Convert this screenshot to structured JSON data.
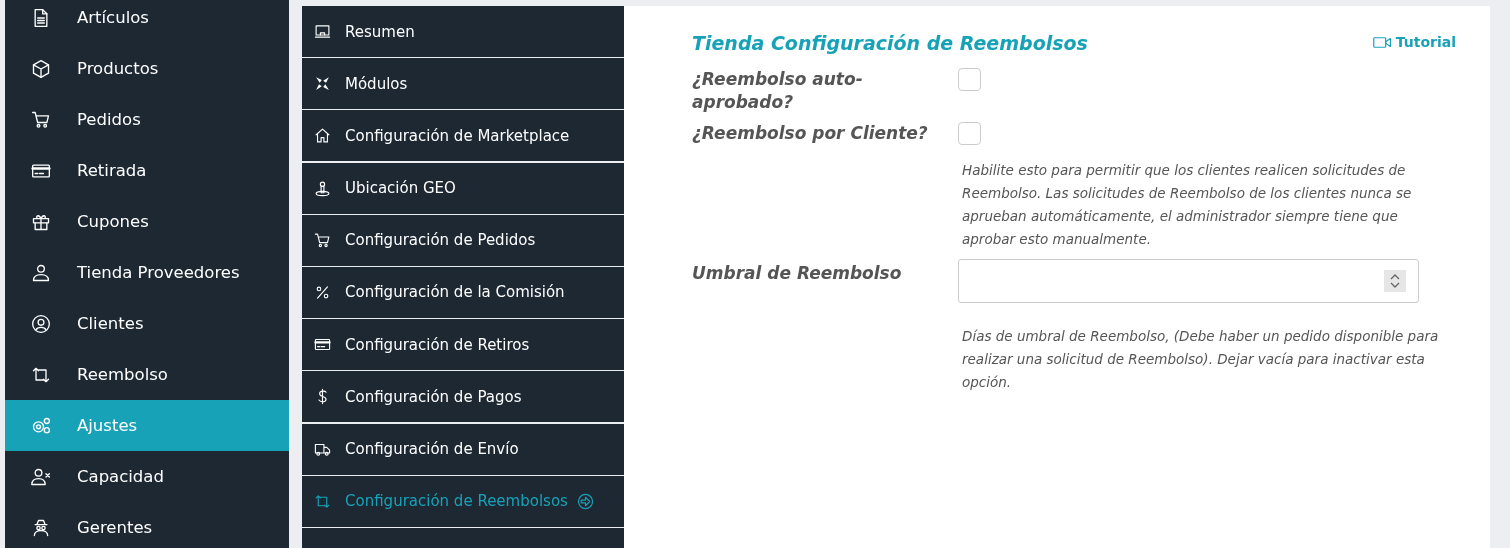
{
  "sidebar": {
    "items": [
      {
        "label": "Artículos",
        "selected": false
      },
      {
        "label": "Productos",
        "selected": false
      },
      {
        "label": "Pedidos",
        "selected": false
      },
      {
        "label": "Retirada",
        "selected": false
      },
      {
        "label": "Cupones",
        "selected": false
      },
      {
        "label": "Tienda Proveedores",
        "selected": false
      },
      {
        "label": "Clientes",
        "selected": false
      },
      {
        "label": "Reembolso",
        "selected": false
      },
      {
        "label": "Ajustes",
        "selected": true
      },
      {
        "label": "Capacidad",
        "selected": false
      },
      {
        "label": "Gerentes",
        "selected": false
      }
    ]
  },
  "settings_menu": {
    "items": [
      {
        "label": "Resumen",
        "selected": false
      },
      {
        "label": "Módulos",
        "selected": false
      },
      {
        "label": "Configuración de Marketplace",
        "selected": false
      },
      {
        "label": "Ubicación GEO",
        "selected": false
      },
      {
        "label": "Configuración de Pedidos",
        "selected": false
      },
      {
        "label": "Configuración de la Comisión",
        "selected": false
      },
      {
        "label": "Configuración de Retiros",
        "selected": false
      },
      {
        "label": "Configuración de Pagos",
        "selected": false
      },
      {
        "label": "Configuración de Envío",
        "selected": false
      },
      {
        "label": "Configuración de Reembolsos",
        "selected": true
      }
    ]
  },
  "content": {
    "title": "Tienda Configuración de Reembolsos",
    "tutorial_link": "Tutorial",
    "fields": [
      {
        "kind": "checkbox",
        "label": "¿Reembolso auto-aprobado?",
        "checked": false
      },
      {
        "kind": "checkbox",
        "label": "¿Reembolso por Cliente?",
        "checked": false,
        "help": "Habilite esto para permitir que los clientes realicen solicitudes de Reembolso. Las solicitudes de Reembolso de los clientes nunca se aprueban automáticamente, el administrador siempre tiene que aprobar esto manualmente."
      },
      {
        "kind": "number",
        "label": "Umbral de Reembolso",
        "help": "Días de umbral de Reembolso, (Debe haber un pedido disponible para realizar una solicitud de Reembolso). Dejar vacía para inactivar esta opción."
      }
    ]
  }
}
